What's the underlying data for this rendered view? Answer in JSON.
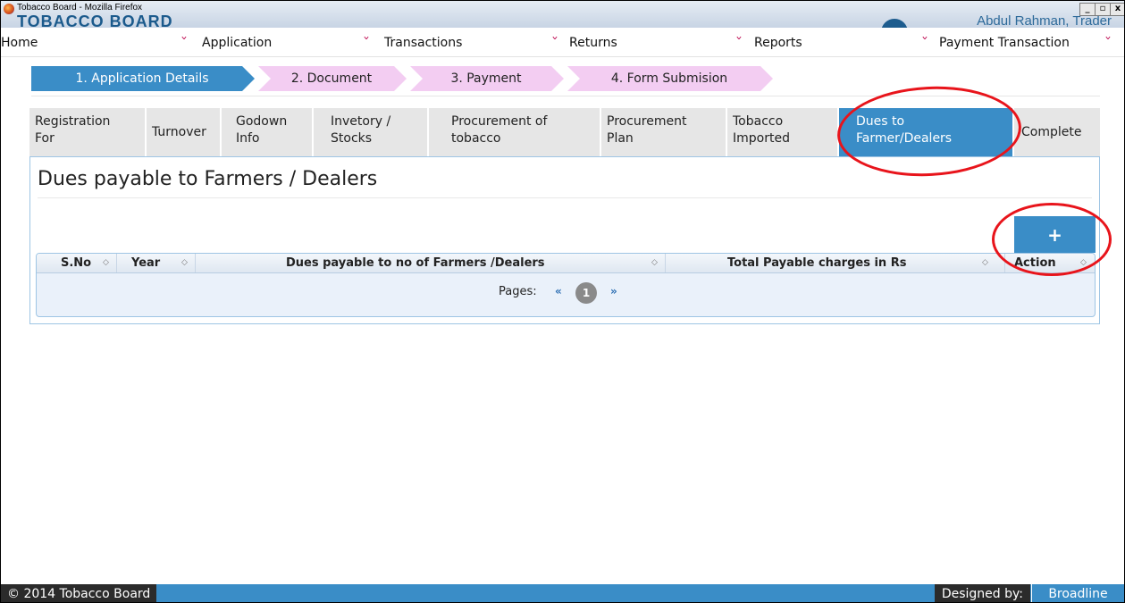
{
  "window": {
    "title": "Tobacco Board - Mozilla Firefox",
    "banner": "TOBACCO BOARD",
    "user": "Abdul Rahman, Trader",
    "controls": [
      "_",
      "▫",
      "x"
    ]
  },
  "menu": {
    "items": [
      "Home",
      "Application",
      "Transactions",
      "Returns",
      "Reports",
      "Payment Transaction"
    ],
    "chevron": "˅"
  },
  "steps": [
    {
      "label": "1. Application Details",
      "state": "active"
    },
    {
      "label": "2. Document",
      "state": "todo"
    },
    {
      "label": "3. Payment",
      "state": "todo"
    },
    {
      "label": "4. Form Submision",
      "state": "todo"
    }
  ],
  "tabs": [
    {
      "line1": "Registration",
      "line2": "For"
    },
    {
      "line1": "Turnover",
      "line2": ""
    },
    {
      "line1": "Godown",
      "line2": "Info"
    },
    {
      "line1": "Invetory /",
      "line2": "Stocks"
    },
    {
      "line1": "Procurement of",
      "line2": "tobacco"
    },
    {
      "line1": "Procurement",
      "line2": "Plan"
    },
    {
      "line1": "Tobacco",
      "line2": "Imported"
    },
    {
      "line1": "Dues to",
      "line2": "Farmer/Dealers"
    },
    {
      "line1": "Complete",
      "line2": ""
    }
  ],
  "panel": {
    "title": "Dues payable to Farmers / Dealers",
    "add_button": "+"
  },
  "table": {
    "columns": [
      "S.No",
      "Year",
      "Dues payable to no of Farmers /Dealers",
      "Total Payable charges in Rs",
      "Action"
    ],
    "sort_glyph": "◇",
    "rows": []
  },
  "pager": {
    "label": "Pages:",
    "prev": "«",
    "current": "1",
    "next": "»"
  },
  "footer": {
    "copyright": "© 2014 Tobacco Board",
    "designed_by": "Designed by:",
    "designer": "Broadline"
  },
  "colors": {
    "accent": "#3a8dc7",
    "step_todo": "#f3cdf2",
    "tab_inactive": "#e6e6e6",
    "annotation": "#e8141b"
  }
}
